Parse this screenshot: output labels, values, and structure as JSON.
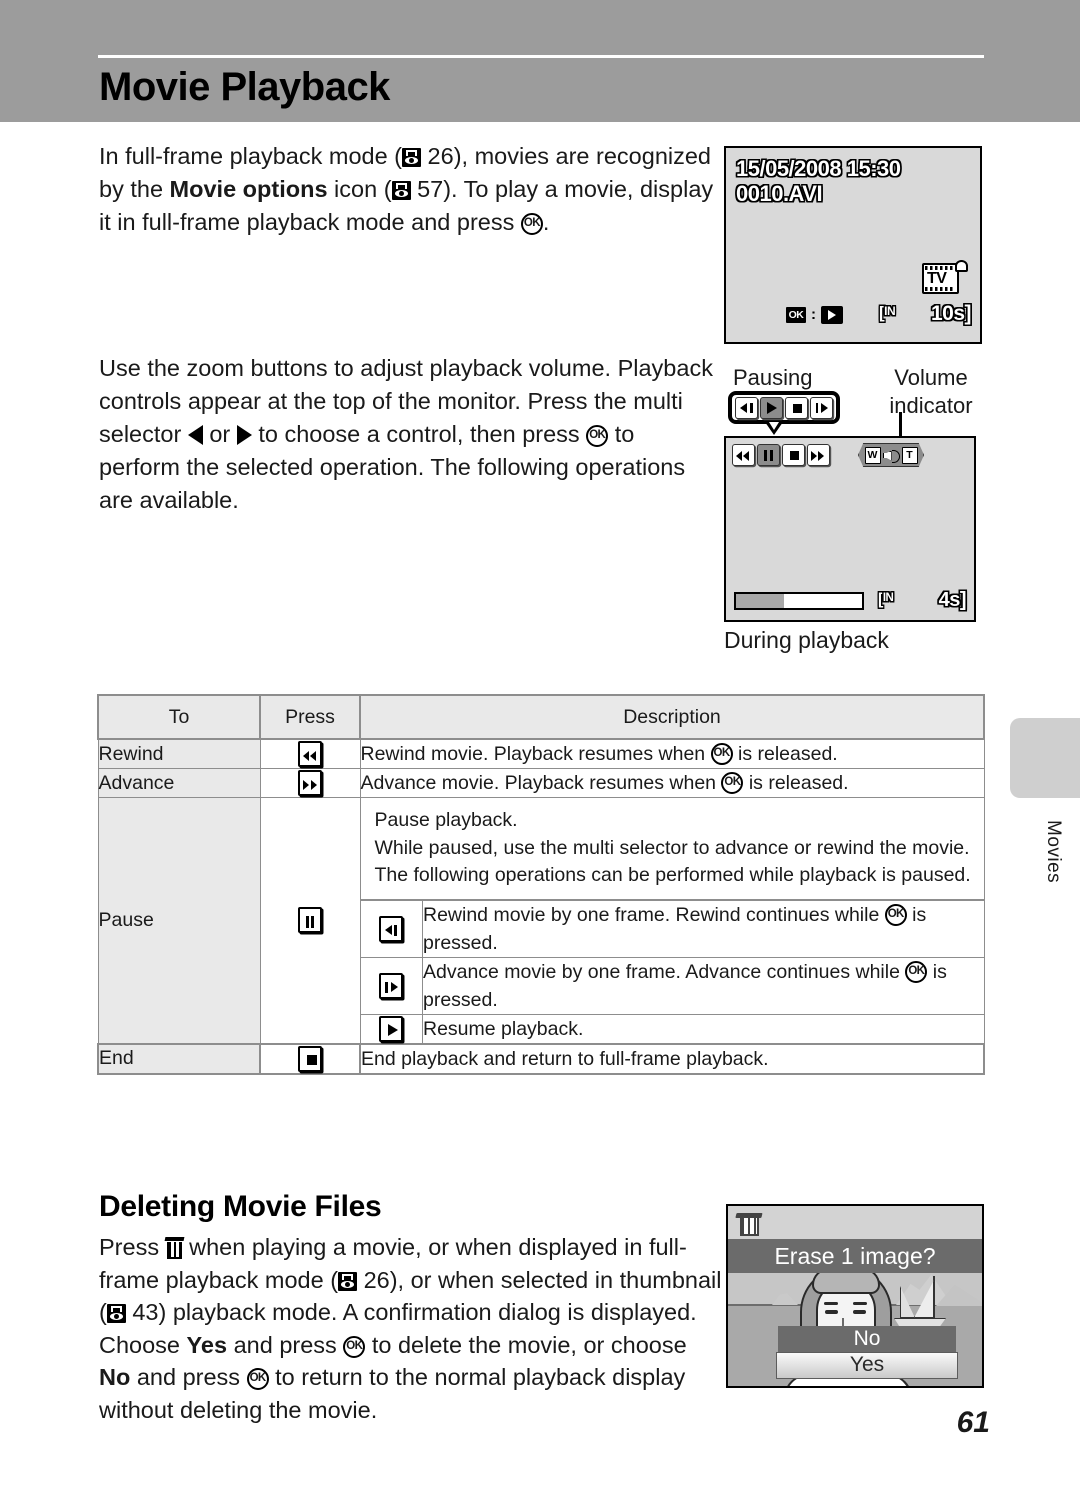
{
  "page": {
    "title": "Movie Playback",
    "number": "61",
    "margin_tab_label": "Movies"
  },
  "intro": {
    "line1_a": "In full-frame playback mode (",
    "line1_ref": "26",
    "line1_b": "), movies are recognized by the ",
    "bold_movie_options": "Movie options",
    "line1_c": " icon (",
    "line2_ref": "57",
    "line1_d": "). To play a movie, display it in full-frame playback mode and press ",
    "ok_label": "OK",
    "line1_e": "."
  },
  "controls_para": {
    "a": "Use the zoom buttons to adjust playback volume. Playback controls appear at the top of the monitor. Press the multi selector ",
    "b": " or ",
    "c": " to choose a control, then press ",
    "ok_label": "OK",
    "d": " to perform the selected operation. The following operations are available."
  },
  "screen_fullframe": {
    "datetime": "15/05/2008 15:30",
    "filename": "0010.AVI",
    "ok_label": "OK",
    "colon": ":",
    "memory": "IN",
    "memory_sup": "IN",
    "duration": "10s]",
    "duration_open": "[",
    "movie_options_label": "TV"
  },
  "screen_playback": {
    "label_pausing": "Pausing",
    "label_volume_line1": "Volume",
    "label_volume_line2": "indicator",
    "label_caption": "During playback",
    "callout_buttons": [
      {
        "name": "rewind-one-frame",
        "selected": false
      },
      {
        "name": "play",
        "selected": true
      },
      {
        "name": "stop",
        "selected": false
      },
      {
        "name": "advance-one-frame",
        "selected": false
      }
    ],
    "screen_buttons": [
      {
        "name": "rewind",
        "selected": false
      },
      {
        "name": "pause",
        "selected": true
      },
      {
        "name": "stop",
        "selected": false
      },
      {
        "name": "fast-forward",
        "selected": false
      }
    ],
    "volume_wide": "W",
    "volume_tele": "T",
    "progress_percent": 38,
    "memory": "IN",
    "duration": "4s]",
    "duration_open": "["
  },
  "table": {
    "headers": {
      "to": "To",
      "press": "Press",
      "description": "Description"
    },
    "rows": [
      {
        "to": "Rewind",
        "press_icon": "rewind-button-icon",
        "desc_a": "Rewind movie. Playback resumes when ",
        "ok_label": "OK",
        "desc_b": " is released."
      },
      {
        "to": "Advance",
        "press_icon": "advance-button-icon",
        "desc_a": "Advance movie. Playback resumes when ",
        "ok_label": "OK",
        "desc_b": " is released."
      }
    ],
    "pause_row": {
      "to": "Pause",
      "press_icon": "pause-button-icon",
      "intro_line1": "Pause playback.",
      "intro_line2": "While paused, use the multi selector to advance or rewind the movie. The following operations can be performed while playback is paused.",
      "sub_rows": [
        {
          "icon": "rewind-one-frame-icon",
          "desc_a": "Rewind movie by one frame. Rewind continues while ",
          "ok_label": "OK",
          "desc_b": " is pressed."
        },
        {
          "icon": "advance-one-frame-icon",
          "desc_a": "Advance movie by one frame. Advance continues while ",
          "ok_label": "OK",
          "desc_b": " is pressed."
        },
        {
          "icon": "resume-play-icon",
          "desc_a": "Resume playback.",
          "ok_label": "",
          "desc_b": ""
        }
      ]
    },
    "end_row": {
      "to": "End",
      "press_icon": "stop-button-icon",
      "desc": "End playback and return to full-frame playback."
    }
  },
  "deleting": {
    "heading": "Deleting Movie Files",
    "a": "Press ",
    "b": " when playing a movie, or when displayed in full-frame playback mode (",
    "ref1": "26",
    "c": "), or when selected in thumbnail (",
    "ref2": "43",
    "d": ") playback mode. A confirmation dialog is displayed. Choose ",
    "yes_bold": "Yes",
    "e": " and press ",
    "ok_label": "OK",
    "f": " to delete the movie, or choose ",
    "no_bold": "No",
    "g": " and press ",
    "ok_label2": "OK",
    "h": " to return to the normal playback display without deleting the movie."
  },
  "erase_dialog": {
    "prompt": "Erase 1 image?",
    "option_no": "No",
    "option_yes": "Yes",
    "selected": "Yes"
  },
  "colors": {
    "header_band": "#9c9c9c",
    "table_label_bg": "#e9e9e9",
    "screen_bg": "#d9d9d9",
    "selected_control": "#8c8c8c",
    "tab_bg": "#cfcfcf"
  }
}
